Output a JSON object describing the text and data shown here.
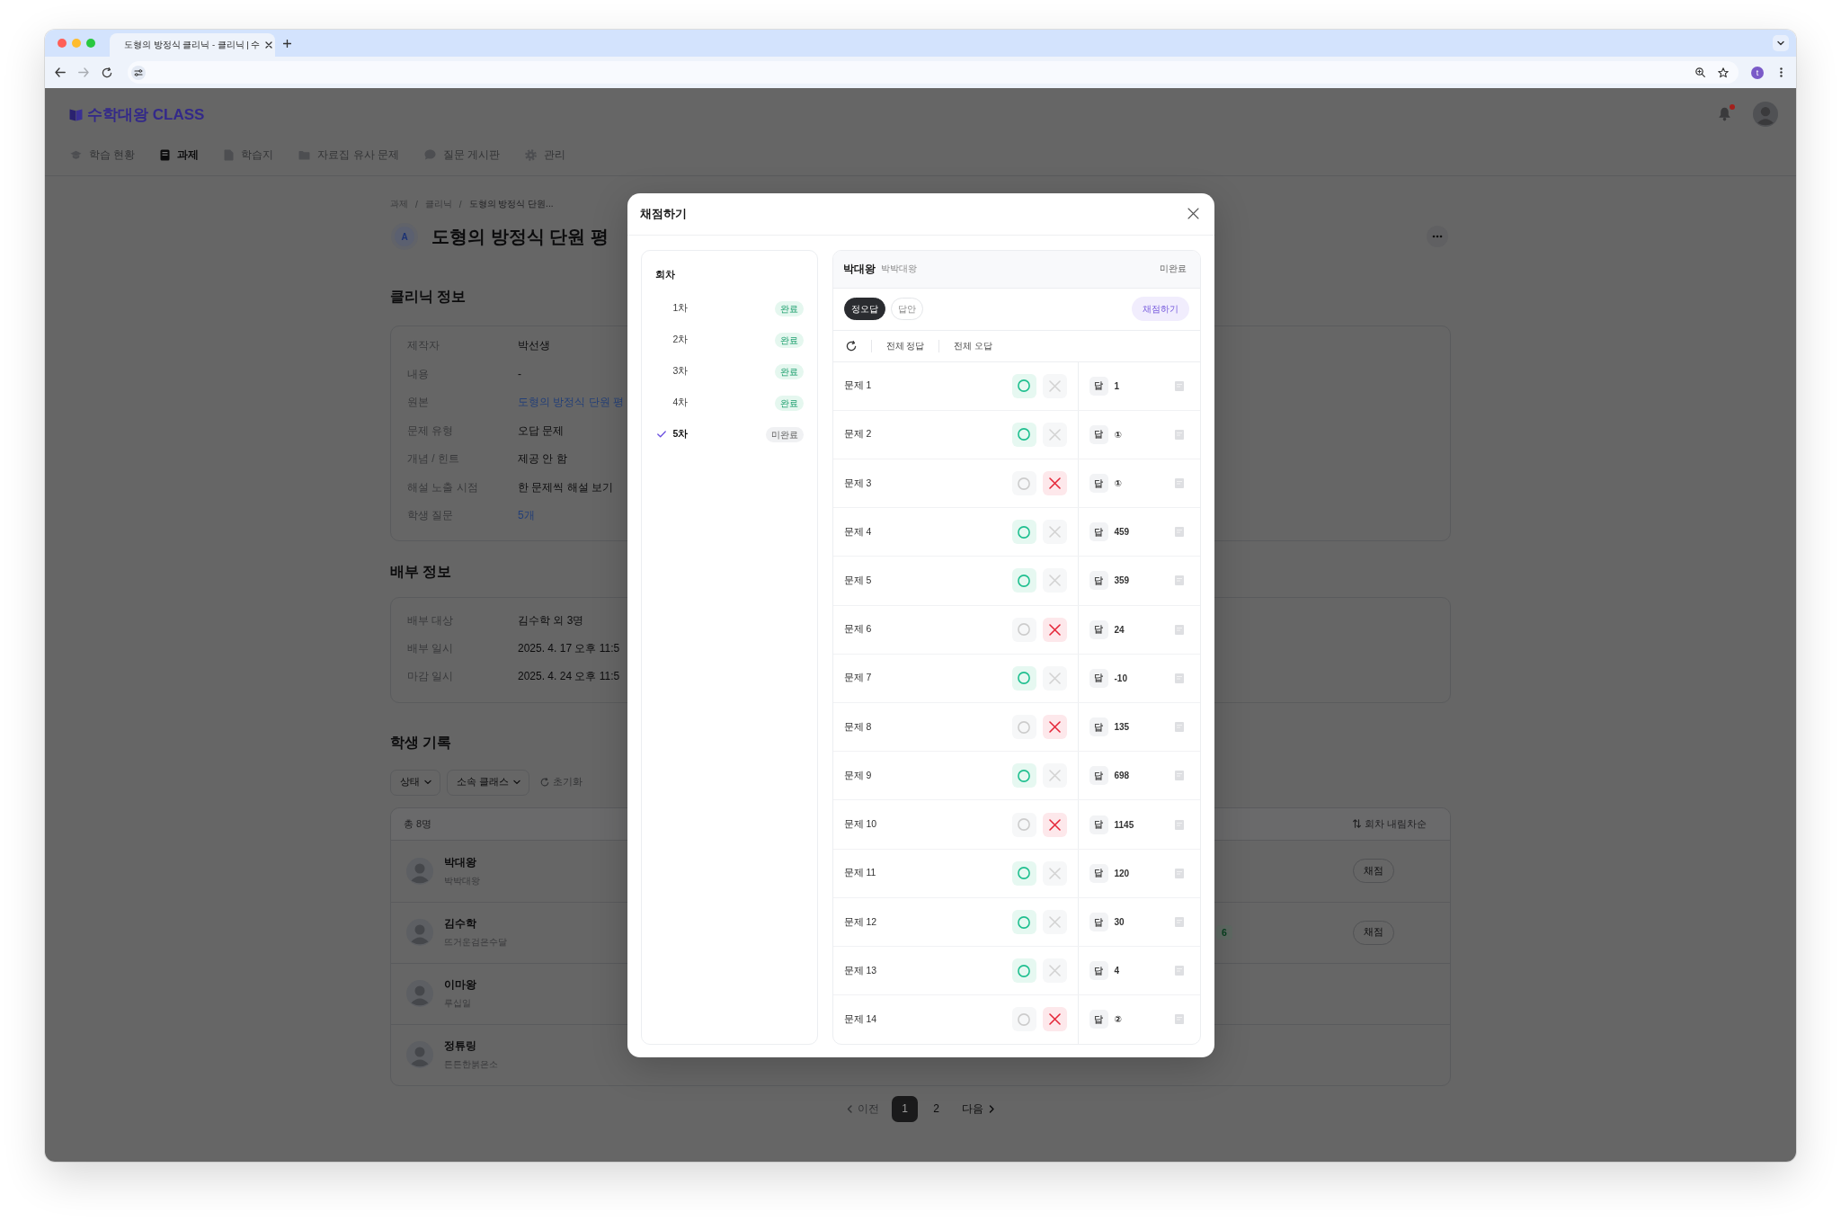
{
  "browser": {
    "tab_title": "도형의 방정식 클리닉 - 클리닉 | 수",
    "profile_initial": "t"
  },
  "app_header": {
    "logo": "수학대왕 CLASS",
    "nav": [
      {
        "label": "학습 현황",
        "kind": "progress",
        "selected": false
      },
      {
        "label": "과제",
        "kind": "assignment",
        "selected": true
      },
      {
        "label": "학습지",
        "kind": "worksheet",
        "selected": false
      },
      {
        "label": "자료집 유사 문제",
        "kind": "library",
        "selected": false
      },
      {
        "label": "질문 게시판",
        "kind": "board",
        "selected": false
      },
      {
        "label": "관리",
        "kind": "admin",
        "selected": false
      }
    ],
    "unread_notifications": true
  },
  "page": {
    "breadcrumb": [
      {
        "label": "과제",
        "current": false
      },
      {
        "label": "클리닉",
        "current": false
      },
      {
        "label": "도형의 방정식 단원...",
        "current": true
      }
    ],
    "breadcrumb_separators": [
      "/",
      "/"
    ],
    "title_badge": "A",
    "title": "도형의 방정식 단원 평",
    "clinic_info": {
      "heading": "클리닉 정보",
      "rows": [
        {
          "label": "제작자",
          "value": "박선생",
          "kind": "text"
        },
        {
          "label": "내용",
          "value": "-",
          "kind": "text"
        },
        {
          "label": "원본",
          "value": "도형의 방정식 단원 평",
          "kind": "link"
        },
        {
          "label": "문제 유형",
          "value": "오답 문제",
          "kind": "text"
        },
        {
          "label": "개념 / 힌트",
          "value": "제공 안 함",
          "kind": "text"
        },
        {
          "label": "해설 노출 시점",
          "value": "한 문제씩 해설 보기",
          "kind": "text"
        },
        {
          "label": "학생 질문",
          "value": "5개",
          "kind": "link"
        }
      ]
    },
    "distribution_info": {
      "heading": "배부 정보",
      "rows": [
        {
          "label": "배부 대상",
          "value": "김수학 외 3명",
          "kind": "text"
        },
        {
          "label": "배부 일시",
          "value": "2025. 4. 17 오후 11:5",
          "kind": "text"
        },
        {
          "label": "마감 일시",
          "value": "2025. 4. 24 오후 11:5",
          "kind": "text"
        }
      ]
    },
    "student_records": {
      "heading": "학생 기록",
      "filters": [
        {
          "label": "상태"
        },
        {
          "label": "소속 클래스"
        }
      ],
      "reset": {
        "label": "초기화",
        "disabled": true
      },
      "total": "총 8명",
      "sort": "회차 내림차순",
      "rows": [
        {
          "name": "박대왕",
          "nickname": "박박대왕",
          "action": "채점"
        },
        {
          "name": "김수학",
          "nickname": "뜨거운검은수달",
          "count": "6",
          "action": "채점"
        },
        {
          "name": "이마왕",
          "nickname": "루십일"
        },
        {
          "name": "정튜링",
          "nickname": "튼튼한붉은소"
        }
      ]
    },
    "pagination": {
      "previous": {
        "label": "이전",
        "disabled": true
      },
      "pages": [
        {
          "label": "1",
          "selected": true
        },
        {
          "label": "2",
          "selected": false
        }
      ],
      "next": {
        "label": "다음",
        "disabled": false
      }
    }
  },
  "grading_modal": {
    "title": "채점하기",
    "rounds_heading": "회차",
    "rounds": [
      {
        "label": "1차",
        "status": "완료",
        "complete": true,
        "selected": false
      },
      {
        "label": "2차",
        "status": "완료",
        "complete": true,
        "selected": false
      },
      {
        "label": "3차",
        "status": "완료",
        "complete": true,
        "selected": false
      },
      {
        "label": "4차",
        "status": "완료",
        "complete": true,
        "selected": false
      },
      {
        "label": "5차",
        "status": "미완료",
        "complete": false,
        "selected": true
      }
    ],
    "student": {
      "name": "박대왕",
      "nickname": "박박대왕",
      "status": "미완료"
    },
    "view_tabs": [
      {
        "label": "정오답",
        "selected": true
      },
      {
        "label": "답안",
        "selected": false
      }
    ],
    "grade_button": "채점하기",
    "bulk_actions": [
      "전체 정답",
      "전체 오답"
    ],
    "problems": [
      {
        "label": "문제 1",
        "correct": true,
        "answer_tag": "답",
        "answer": "1"
      },
      {
        "label": "문제 2",
        "correct": true,
        "answer_tag": "답",
        "answer": "①"
      },
      {
        "label": "문제 3",
        "correct": false,
        "answer_tag": "답",
        "answer": "①"
      },
      {
        "label": "문제 4",
        "correct": true,
        "answer_tag": "답",
        "answer": "459"
      },
      {
        "label": "문제 5",
        "correct": true,
        "answer_tag": "답",
        "answer": "359"
      },
      {
        "label": "문제 6",
        "correct": false,
        "answer_tag": "답",
        "answer": "24"
      },
      {
        "label": "문제 7",
        "correct": true,
        "answer_tag": "답",
        "answer": "-10"
      },
      {
        "label": "문제 8",
        "correct": false,
        "answer_tag": "답",
        "answer": "135"
      },
      {
        "label": "문제 9",
        "correct": true,
        "answer_tag": "답",
        "answer": "698"
      },
      {
        "label": "문제 10",
        "correct": false,
        "answer_tag": "답",
        "answer": "1145"
      },
      {
        "label": "문제 11",
        "correct": true,
        "answer_tag": "답",
        "answer": "120"
      },
      {
        "label": "문제 12",
        "correct": true,
        "answer_tag": "답",
        "answer": "30"
      },
      {
        "label": "문제 13",
        "correct": true,
        "answer_tag": "답",
        "answer": "4"
      },
      {
        "label": "문제 14",
        "correct": false,
        "answer_tag": "답",
        "answer": "②"
      }
    ]
  }
}
